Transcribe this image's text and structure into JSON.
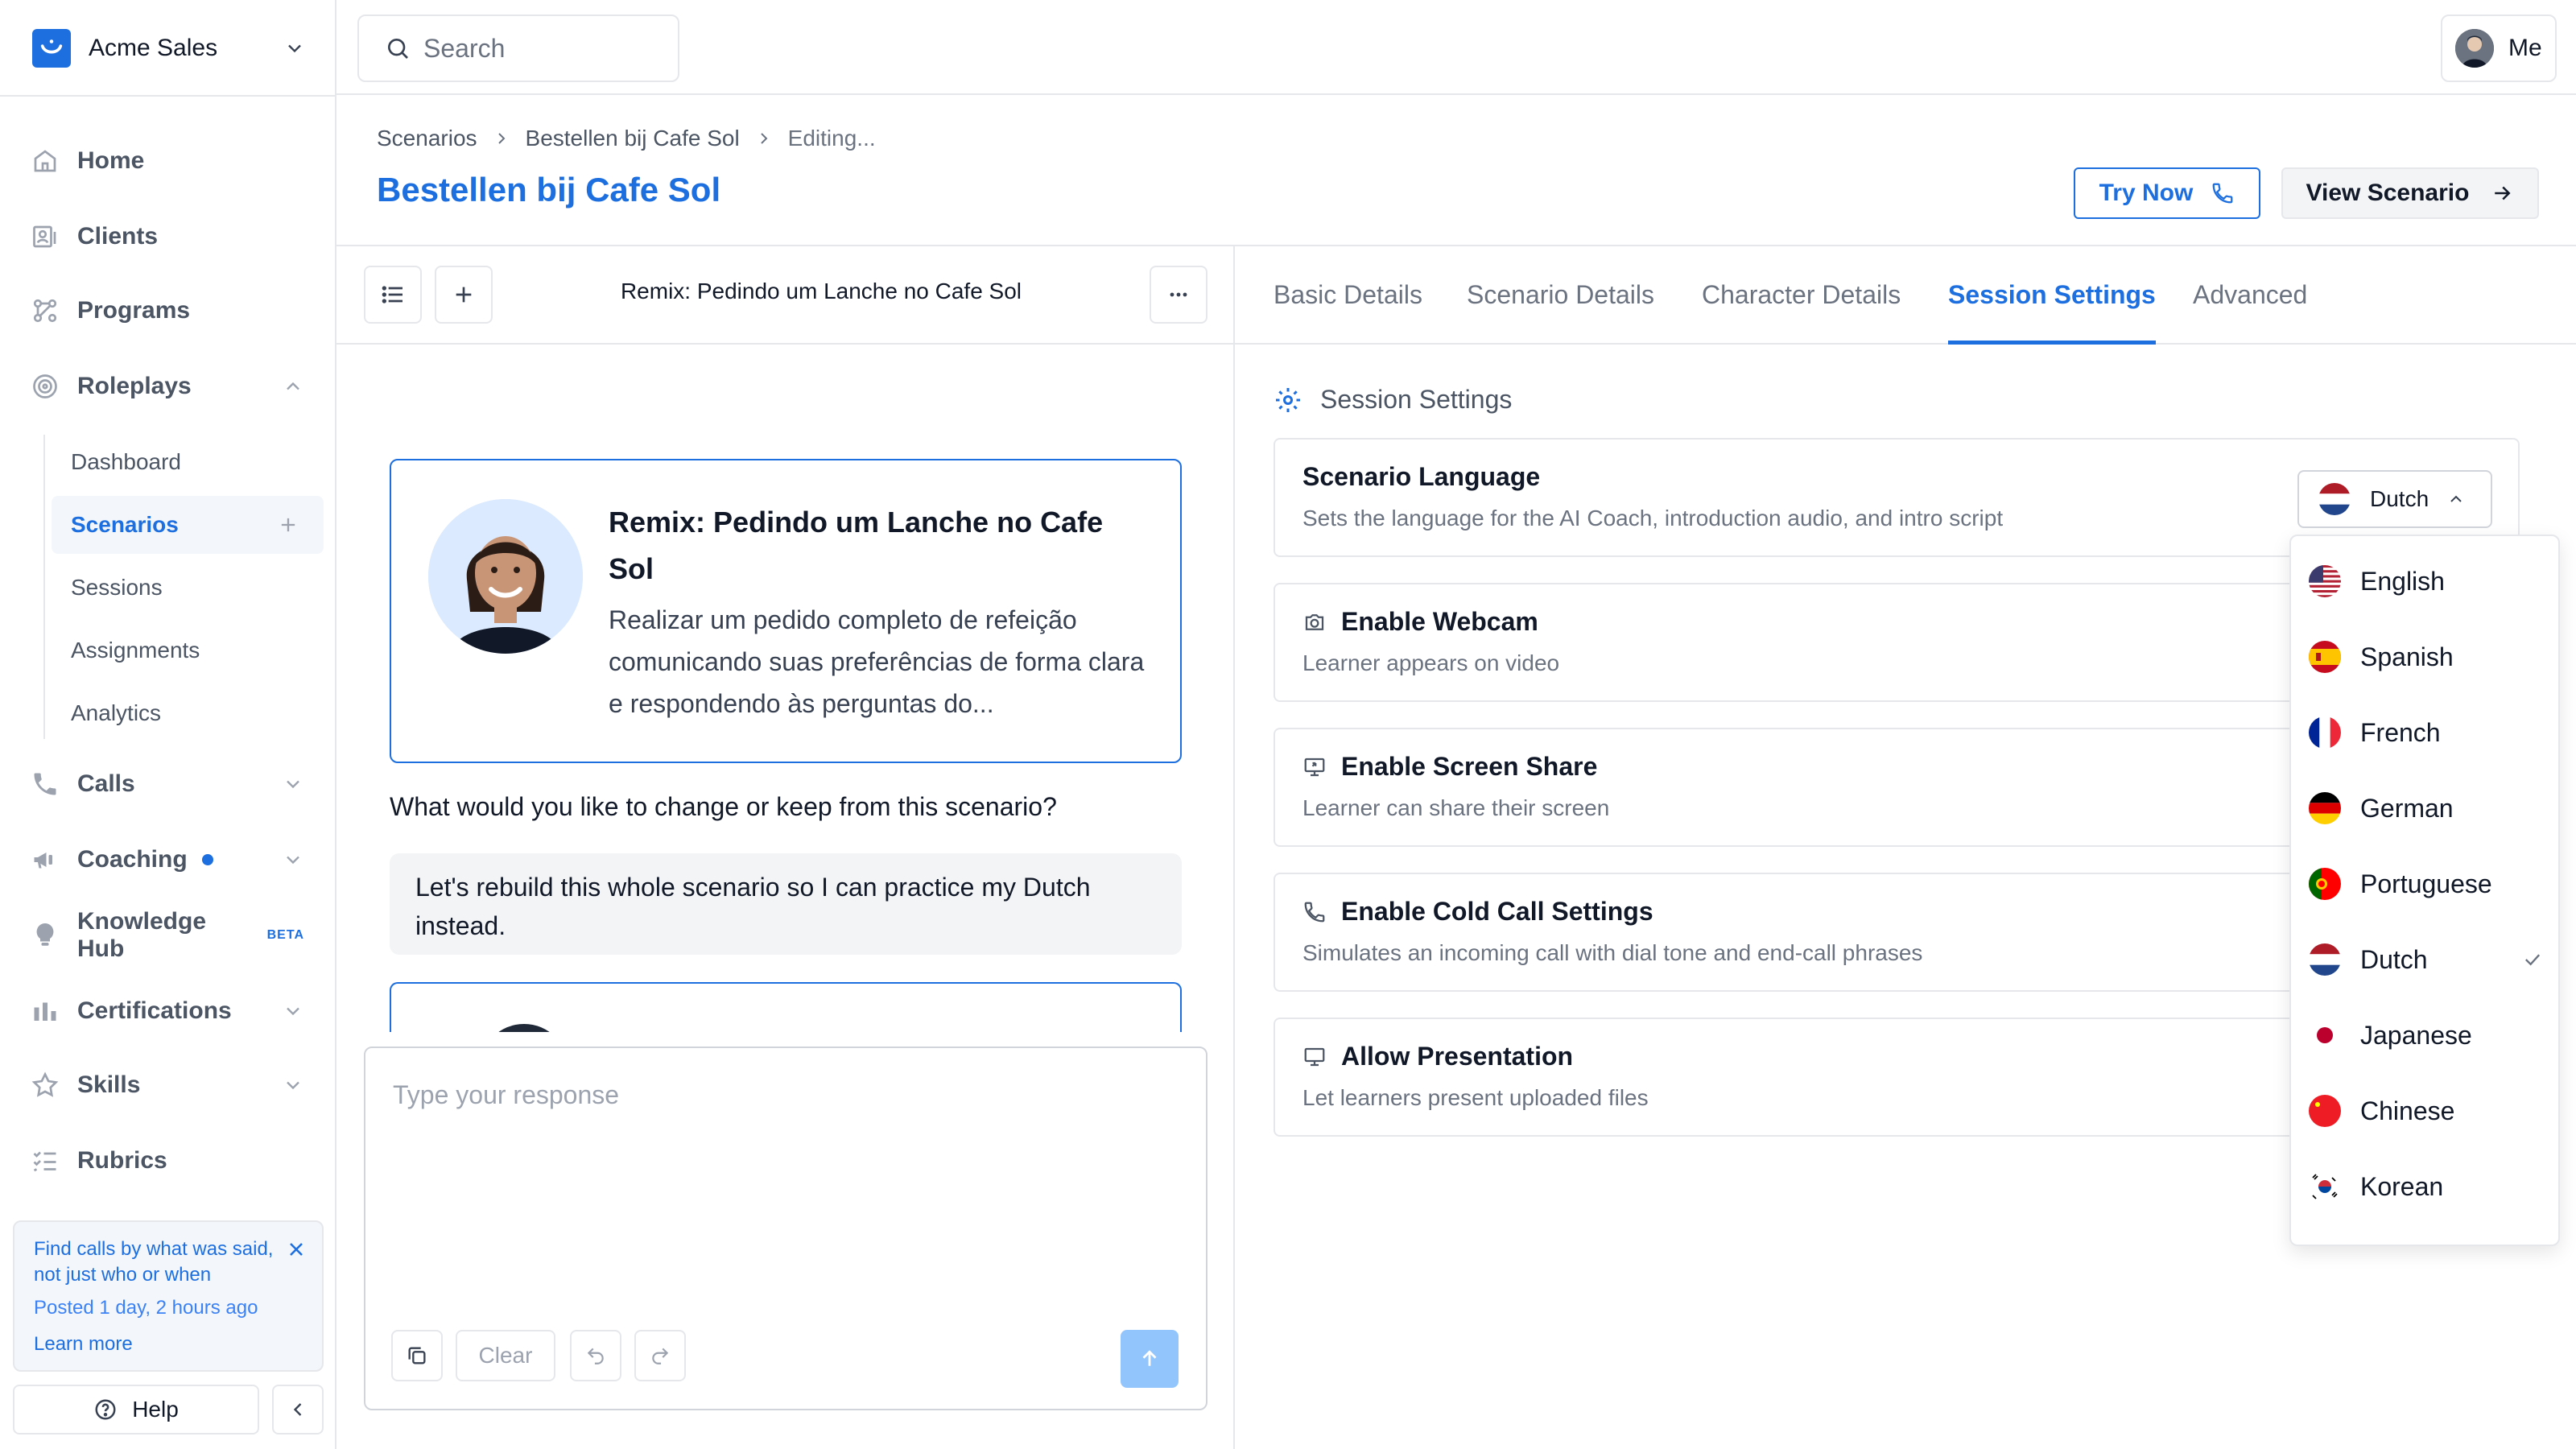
{
  "sidebar": {
    "org_name": "Acme Sales",
    "nav": {
      "home": "Home",
      "clients": "Clients",
      "programs": "Programs",
      "roleplays": "Roleplays",
      "calls": "Calls",
      "coaching": "Coaching",
      "knowledge_hub": "Knowledge Hub",
      "knowledge_hub_badge": "BETA",
      "certifications": "Certifications",
      "skills": "Skills",
      "rubrics": "Rubrics"
    },
    "roleplays_sub": [
      "Dashboard",
      "Scenarios",
      "Sessions",
      "Assignments",
      "Analytics"
    ],
    "promo": {
      "text": "Find calls by what was said, not just who or when",
      "posted": "Posted 1 day, 2 hours ago",
      "link": "Learn more"
    },
    "help": "Help"
  },
  "topbar": {
    "search_placeholder": "Search",
    "user_label": "Me"
  },
  "header": {
    "breadcrumbs": [
      "Scenarios",
      "Bestellen bij Cafe Sol",
      "Editing..."
    ],
    "title": "Bestellen bij Cafe Sol",
    "try_now": "Try Now",
    "view_scenario": "View Scenario"
  },
  "chat": {
    "title": "Remix: Pedindo um Lanche no Cafe Sol",
    "card": {
      "title": "Remix: Pedindo um Lanche no Cafe Sol",
      "description": "Realizar um pedido completo de refeição comunicando suas preferências de forma clara e respondendo às perguntas do..."
    },
    "question": "What would you like to change or keep from this scenario?",
    "user_message": "Let's rebuild this whole scenario so I can practice my Dutch instead.",
    "composer_placeholder": "Type your response",
    "clear": "Clear"
  },
  "tabs": [
    "Basic Details",
    "Scenario Details",
    "Character Details",
    "Session Settings",
    "Advanced"
  ],
  "active_tab": "Session Settings",
  "session": {
    "heading": "Session Settings",
    "language": {
      "title": "Scenario Language",
      "desc": "Sets the language for the AI Coach, introduction audio, and intro script",
      "selected": "Dutch"
    },
    "settings": [
      {
        "title": "Enable Webcam",
        "desc": "Learner appears on video",
        "icon": "camera-icon"
      },
      {
        "title": "Enable Screen Share",
        "desc": "Learner can share their screen",
        "icon": "screen-share-icon"
      },
      {
        "title": "Enable Cold Call Settings",
        "desc": "Simulates an incoming call with dial tone and end-call phrases",
        "icon": "phone-icon"
      },
      {
        "title": "Allow Presentation",
        "desc": "Let learners present uploaded files",
        "icon": "presentation-icon"
      }
    ]
  },
  "language_options": [
    "English",
    "Spanish",
    "French",
    "German",
    "Portuguese",
    "Dutch",
    "Japanese",
    "Chinese",
    "Korean"
  ],
  "colors": {
    "accent": "#1d6fe0",
    "border": "#e5e7eb",
    "send_disabled": "#93c5fd"
  }
}
